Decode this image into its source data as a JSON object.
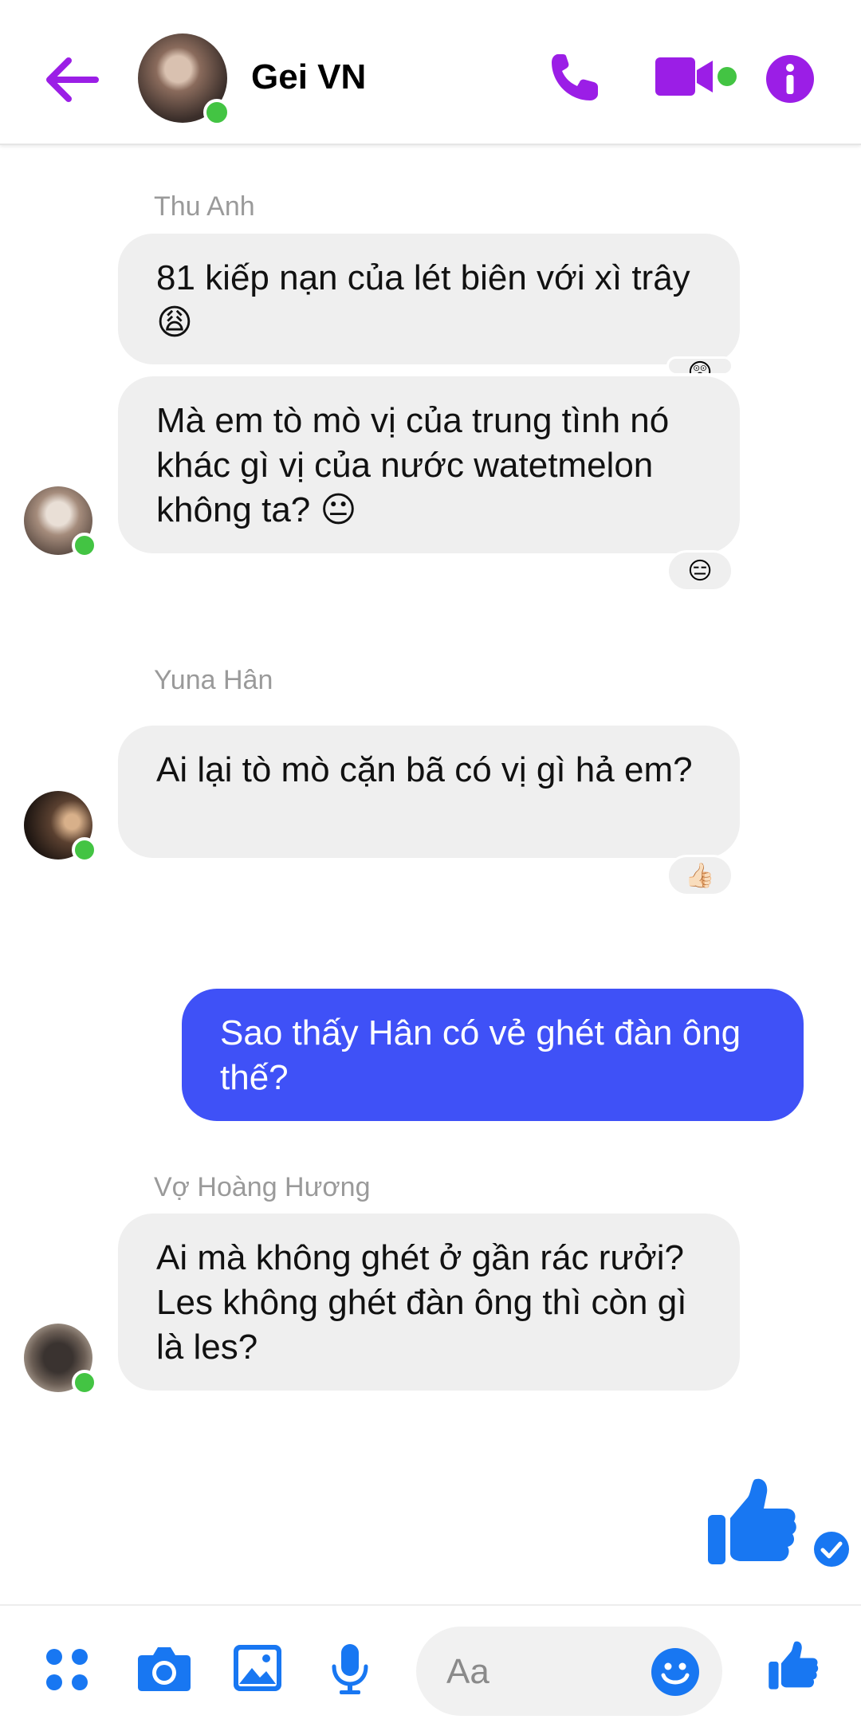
{
  "header": {
    "title": "Gei VN",
    "colors": {
      "accent": "#9b1ee6",
      "online": "#43c443"
    }
  },
  "messages": [
    {
      "sender": "Thu Anh",
      "text": "81 kiếp nạn của lét biên với xì trây 😩",
      "reaction": "😲"
    },
    {
      "text": "Mà em tò mò vị của trung tình nó khác gì vị của nước watetmelon không ta? 😐",
      "reaction": "😑"
    },
    {
      "sender": "Yuna Hân",
      "text": "Ai lại tò mò cặn bã có vị gì hả em?",
      "reaction": "👍🏻"
    },
    {
      "text": "Sao thấy Hân có vẻ ghét đàn ông thế?",
      "mine": true
    },
    {
      "sender": "Vợ Hoàng Hương",
      "text": "Ai mà không ghét ở gần rác rưởi? Les không ghét đàn ông thì còn gì là les?"
    }
  ],
  "composer": {
    "placeholder": "Aa",
    "colors": {
      "icon": "#1877f2",
      "mine_bubble": "#3f51f7"
    }
  }
}
